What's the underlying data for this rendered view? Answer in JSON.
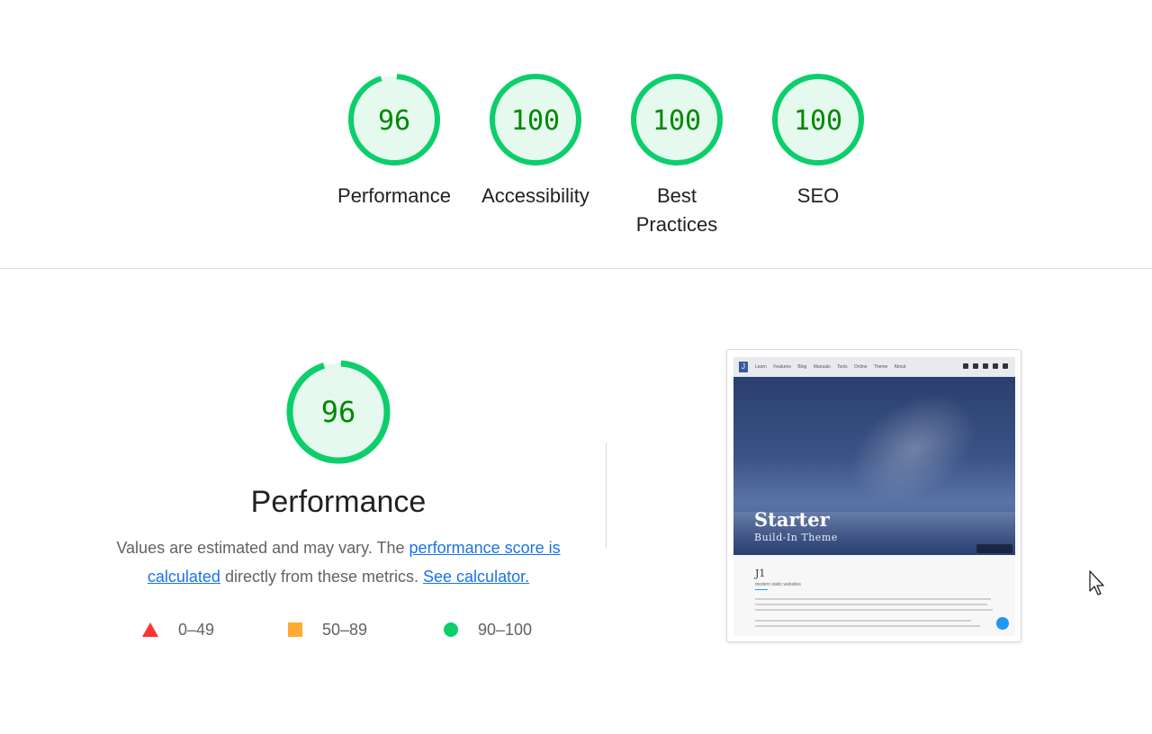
{
  "colors": {
    "pass": "#0cce6b",
    "pass_text": "#008800",
    "pass_bg": "#e5f9ee",
    "average": "#ffaa33",
    "fail": "#ff3333",
    "link": "#1a73e8"
  },
  "gauges": [
    {
      "score": "96",
      "label": "Performance",
      "fraction": 0.96
    },
    {
      "score": "100",
      "label": "Accessibility",
      "fraction": 1.0
    },
    {
      "score": "100",
      "label": "Best Practices",
      "fraction": 1.0
    },
    {
      "score": "100",
      "label": "SEO",
      "fraction": 1.0
    }
  ],
  "performance": {
    "score": "96",
    "fraction": 0.96,
    "title": "Performance",
    "desc_prefix": "Values are estimated and may vary. The ",
    "link_score": "performance score is calculated",
    "desc_middle": " directly from these metrics. ",
    "link_calc": "See calculator."
  },
  "legend": [
    {
      "range": "0–49",
      "icon": "triangle-icon"
    },
    {
      "range": "50–89",
      "icon": "square-icon"
    },
    {
      "range": "90–100",
      "icon": "circle-icon"
    }
  ],
  "thumbnail": {
    "menu": [
      "Learn",
      "Features",
      "Blog",
      "Manuals",
      "Tools",
      "Online",
      "Theme",
      "About"
    ],
    "hero_title": "Starter",
    "hero_subtitle": "Build-In Theme",
    "body_title": "J1",
    "body_subtitle": "modern static websites"
  }
}
